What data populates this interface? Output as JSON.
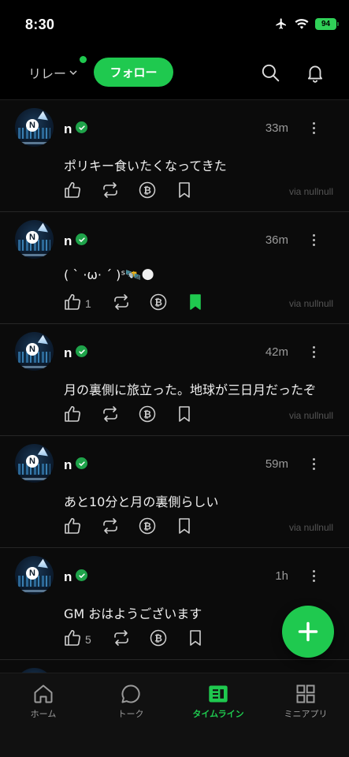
{
  "status_bar": {
    "time": "8:30",
    "battery": "94"
  },
  "header": {
    "relay_label": "リレー",
    "follow_label": "フォロー"
  },
  "posts": [
    {
      "name": "n",
      "time": "33m",
      "text": "ポリキー食いたくなってきた",
      "likes": "",
      "bookmarked": false,
      "via": "via nullnull"
    },
    {
      "name": "n",
      "time": "36m",
      "text": "( ˋ ·ω· ˊ )ˢ🛰️🌑",
      "likes": "1",
      "bookmarked": true,
      "via": "via nullnull"
    },
    {
      "name": "n",
      "time": "42m",
      "text": "月の裏側に旅立った。地球が三日月だったぞ",
      "likes": "",
      "bookmarked": false,
      "via": "via nullnull"
    },
    {
      "name": "n",
      "time": "59m",
      "text": "あと10分と月の裏側らしい",
      "likes": "",
      "bookmarked": false,
      "via": "via nullnull"
    },
    {
      "name": "n",
      "time": "1h",
      "text": "GM おはようございます",
      "likes": "5",
      "bookmarked": false,
      "via": ""
    }
  ],
  "tabs": [
    {
      "label": "ホーム",
      "icon": "home-icon",
      "active": false
    },
    {
      "label": "トーク",
      "icon": "chat-bubble-icon",
      "active": false
    },
    {
      "label": "タイムライン",
      "icon": "timeline-icon",
      "active": true
    },
    {
      "label": "ミニアプリ",
      "icon": "grid-icon",
      "active": false
    }
  ],
  "colors": {
    "accent": "#1fc94f",
    "background": "#000000",
    "post_bg": "#0b0b0b"
  }
}
